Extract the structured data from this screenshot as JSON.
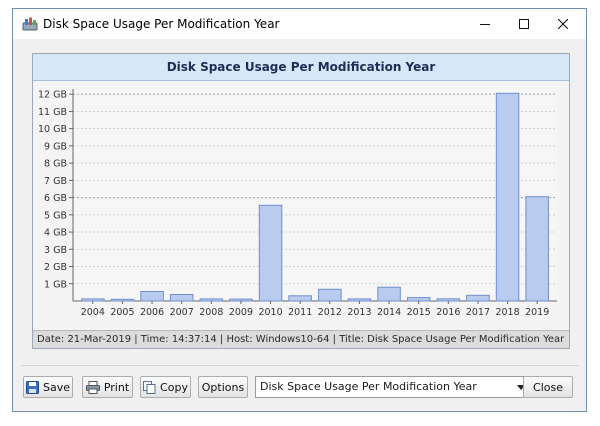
{
  "window": {
    "title": "Disk Space Usage Per Modification Year",
    "icon": "disk-chart-icon"
  },
  "chart_data": {
    "type": "bar",
    "title": "Disk Space Usage Per Modification Year",
    "xlabel": "",
    "ylabel": "",
    "categories": [
      "2004",
      "2005",
      "2006",
      "2007",
      "2008",
      "2009",
      "2010",
      "2011",
      "2012",
      "2013",
      "2014",
      "2015",
      "2016",
      "2017",
      "2018",
      "2019"
    ],
    "values": [
      0.12,
      0.1,
      0.55,
      0.38,
      0.12,
      0.11,
      5.55,
      0.3,
      0.68,
      0.12,
      0.8,
      0.2,
      0.13,
      0.33,
      12.05,
      6.05
    ],
    "unit": "GB",
    "ylim": [
      0,
      12.3
    ],
    "yticks": [
      1,
      2,
      3,
      4,
      5,
      6,
      7,
      8,
      9,
      10,
      11,
      12
    ],
    "ytick_labels": [
      "1 GB",
      "2 GB",
      "3 GB",
      "4 GB",
      "5 GB",
      "6 GB",
      "7 GB",
      "8 GB",
      "9 GB",
      "10 GB",
      "11 GB",
      "12 GB"
    ],
    "grid": true,
    "bar_color": "#b9cbee",
    "bar_edge_color": "#6f8fce"
  },
  "status": {
    "text": "Date: 21-Mar-2019 | Time: 14:37:14 | Host: Windows10-64 | Title: Disk Space Usage Per Modification Year"
  },
  "toolbar": {
    "save_label": "Save",
    "print_label": "Print",
    "copy_label": "Copy",
    "options_label": "Options",
    "selected_chart": "Disk Space Usage Per Modification Year",
    "close_label": "Close"
  },
  "colors": {
    "accent": "#6f8fb5",
    "header_bg": "#d6e7f8"
  }
}
